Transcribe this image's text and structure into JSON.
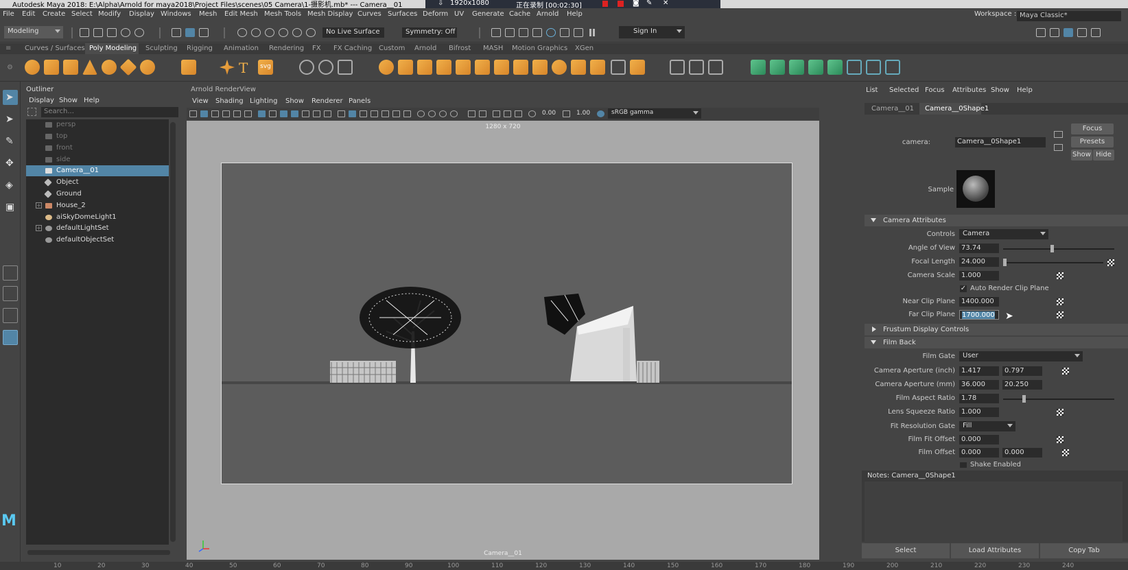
{
  "titlebar": {
    "title": "Autodesk Maya 2018: E:\\Alpha\\Arnold for maya2018\\Project Files\\scenes\\05 Camera\\1-摄影机.mb*  ---  Camera__01",
    "recorder_resolution": "1920x1080",
    "recorder_status": "正在录制 [00:02:30]"
  },
  "menubar": {
    "items": [
      "File",
      "Edit",
      "Create",
      "Select",
      "Modify",
      "Display",
      "Windows",
      "Mesh",
      "Edit Mesh",
      "Mesh Tools",
      "Mesh Display",
      "Curves",
      "Surfaces",
      "Deform",
      "UV",
      "Generate",
      "Cache",
      "Arnold",
      "Help"
    ],
    "workspace_label": "Workspace :",
    "workspace_value": "Maya Classic*"
  },
  "statusline": {
    "mode": "Modeling",
    "live_surface": "No Live Surface",
    "symmetry": "Symmetry: Off",
    "sign_in": "Sign In"
  },
  "shelf": {
    "tabs": [
      "Curves / Surfaces",
      "Poly Modeling",
      "Sculpting",
      "Rigging",
      "Animation",
      "Rendering",
      "FX",
      "FX Caching",
      "Custom",
      "Arnold",
      "Bifrost",
      "MASH",
      "Motion Graphics",
      "XGen"
    ],
    "active_tab": "Poly Modeling"
  },
  "outliner": {
    "title": "Outliner",
    "menu": [
      "Display",
      "Show",
      "Help"
    ],
    "search_placeholder": "Search...",
    "items": [
      {
        "label": "persp"
      },
      {
        "label": "top"
      },
      {
        "label": "front"
      },
      {
        "label": "side"
      },
      {
        "label": "Camera__01"
      },
      {
        "label": "Object"
      },
      {
        "label": "Ground"
      },
      {
        "label": "House_2"
      },
      {
        "label": "aiSkyDomeLight1"
      },
      {
        "label": "defaultLightSet"
      },
      {
        "label": "defaultObjectSet"
      }
    ]
  },
  "renderview": {
    "title": "Arnold RenderView",
    "menu": [
      "View",
      "Shading",
      "Lighting",
      "Show",
      "Renderer",
      "Panels"
    ],
    "exposure": "0.00",
    "gamma": "1.00",
    "color_space": "sRGB gamma",
    "resolution": "1280 x 720",
    "camera_caption": "Camera__01"
  },
  "attribute_editor": {
    "menu": [
      "List",
      "Selected",
      "Focus",
      "Attributes",
      "Show",
      "Help"
    ],
    "tabs": [
      "Camera__01",
      "Camera__0Shape1"
    ],
    "camera_label": "camera:",
    "camera_value": "Camera__0Shape1",
    "focus_btn": "Focus",
    "presets_btn": "Presets",
    "show_btn": "Show",
    "hide_btn": "Hide",
    "sample_label": "Sample",
    "camera_attributes": {
      "title": "Camera Attributes",
      "controls_label": "Controls",
      "controls_value": "Camera",
      "angle_of_view_label": "Angle of View",
      "angle_of_view": "73.74",
      "focal_length_label": "Focal Length",
      "focal_length": "24.000",
      "camera_scale_label": "Camera Scale",
      "camera_scale": "1.000",
      "auto_clip_label": "Auto Render Clip Plane",
      "near_clip_label": "Near Clip Plane",
      "near_clip": "1400.000",
      "far_clip_label": "Far Clip Plane",
      "far_clip": "1700.000"
    },
    "frustum_title": "Frustum Display Controls",
    "film_back": {
      "title": "Film Back",
      "film_gate_label": "Film Gate",
      "film_gate": "User",
      "aperture_inch_label": "Camera Aperture (inch)",
      "aperture_inch_w": "1.417",
      "aperture_inch_h": "0.797",
      "aperture_mm_label": "Camera Aperture (mm)",
      "aperture_mm_w": "36.000",
      "aperture_mm_h": "20.250",
      "aspect_label": "Film Aspect Ratio",
      "aspect": "1.78",
      "squeeze_label": "Lens Squeeze Ratio",
      "squeeze": "1.000",
      "fit_gate_label": "Fit Resolution Gate",
      "fit_gate": "Fill",
      "fit_offset_label": "Film Fit Offset",
      "fit_offset": "0.000",
      "film_offset_label": "Film Offset",
      "film_offset_x": "0.000",
      "film_offset_y": "0.000",
      "shake_label": "Shake Enabled"
    },
    "notes_label": "Notes:  Camera__0Shape1",
    "select_btn": "Select",
    "load_btn": "Load Attributes",
    "copy_btn": "Copy Tab"
  },
  "timeline": {
    "ticks": [
      "10",
      "20",
      "30",
      "40",
      "50",
      "60",
      "70",
      "80",
      "90",
      "100",
      "110",
      "120",
      "130",
      "140",
      "150",
      "160",
      "170",
      "180",
      "190",
      "200",
      "210",
      "220",
      "230",
      "240"
    ]
  }
}
